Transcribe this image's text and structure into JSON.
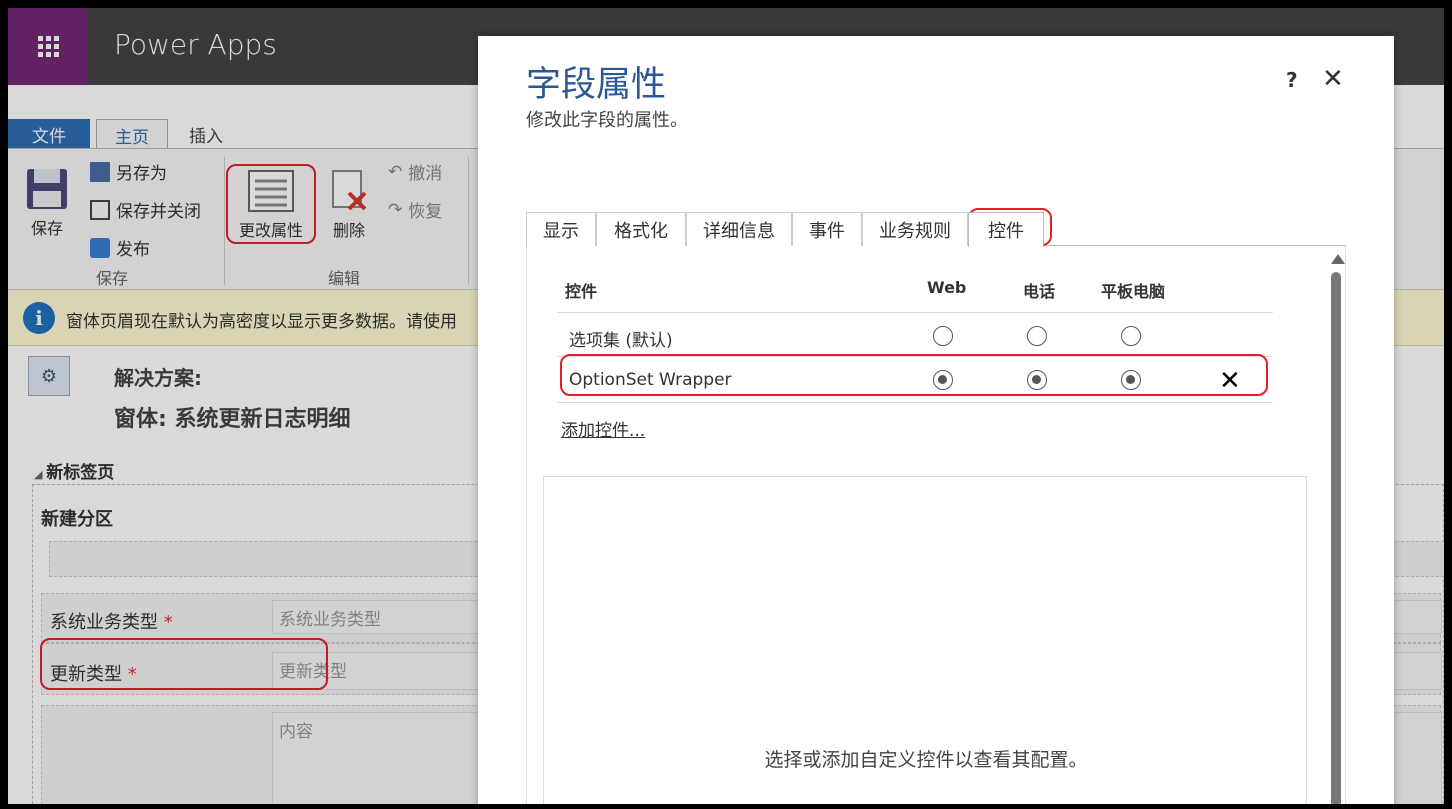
{
  "app": {
    "title": "Power Apps"
  },
  "ribbon": {
    "tabs": {
      "file": "文件",
      "home": "主页",
      "insert": "插入"
    },
    "save": "保存",
    "save_as": "另存为",
    "save_close": "保存并关闭",
    "publish": "发布",
    "group_save": "保存",
    "change_props": "更改属性",
    "delete": "删除",
    "undo": "撤消",
    "redo": "恢复",
    "group_edit": "编辑"
  },
  "infobar": {
    "text": "窗体页眉现在默认为高密度以显示更多数据。请使用"
  },
  "solution": {
    "label": "解决方案:",
    "form": "窗体: 系统更新日志明细"
  },
  "form": {
    "tab_label": "新标签页",
    "section_label": "新建分区",
    "fields": [
      {
        "label": "系统业务类型",
        "required": "*",
        "placeholder": "系统业务类型"
      },
      {
        "label": "更新类型",
        "required": "*",
        "placeholder": "更新类型"
      },
      {
        "label": "",
        "placeholder": "内容"
      }
    ]
  },
  "dialog": {
    "title": "字段属性",
    "subtitle": "修改此字段的属性。",
    "help": "?",
    "close": "✕",
    "tabs": [
      "显示",
      "格式化",
      "详细信息",
      "事件",
      "业务规则",
      "控件"
    ],
    "active_tab": "控件",
    "table": {
      "headers": {
        "control": "控件",
        "web": "Web",
        "phone": "电话",
        "tablet": "平板电脑"
      },
      "rows": [
        {
          "name": "选项集 (默认)",
          "web": false,
          "phone": false,
          "tablet": false
        },
        {
          "name": "OptionSet Wrapper",
          "web": true,
          "phone": true,
          "tablet": true
        }
      ]
    },
    "remove_icon": "✕",
    "add_control": "添加控件...",
    "config_message": "选择或添加自定义控件以查看其配置。"
  }
}
